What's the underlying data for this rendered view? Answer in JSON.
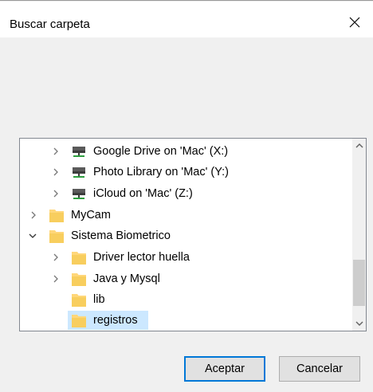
{
  "dialog": {
    "title": "Buscar carpeta",
    "close_icon": "close-icon"
  },
  "tree": {
    "items": [
      {
        "label": "Google Drive on 'Mac' (X:)",
        "icon": "network-drive-icon",
        "expander": "collapsed"
      },
      {
        "label": "Photo Library on 'Mac' (Y:)",
        "icon": "network-drive-icon",
        "expander": "collapsed"
      },
      {
        "label": "iCloud on 'Mac' (Z:)",
        "icon": "network-drive-icon",
        "expander": "collapsed"
      },
      {
        "label": "MyCam",
        "icon": "folder-icon",
        "expander": "collapsed"
      },
      {
        "label": "Sistema Biometrico",
        "icon": "folder-icon",
        "expander": "expanded"
      },
      {
        "label": "Driver lector huella",
        "icon": "folder-icon",
        "expander": "collapsed"
      },
      {
        "label": "Java y Mysql",
        "icon": "folder-icon",
        "expander": "collapsed"
      },
      {
        "label": "lib",
        "icon": "folder-icon",
        "expander": "none"
      },
      {
        "label": "registros",
        "icon": "folder-icon",
        "expander": "none",
        "selected": true
      }
    ]
  },
  "buttons": {
    "ok_label": "Aceptar",
    "cancel_label": "Cancelar"
  },
  "colors": {
    "selection": "#cce8ff",
    "folder": "#ffd77a",
    "default_button_border": "#0078d7"
  }
}
